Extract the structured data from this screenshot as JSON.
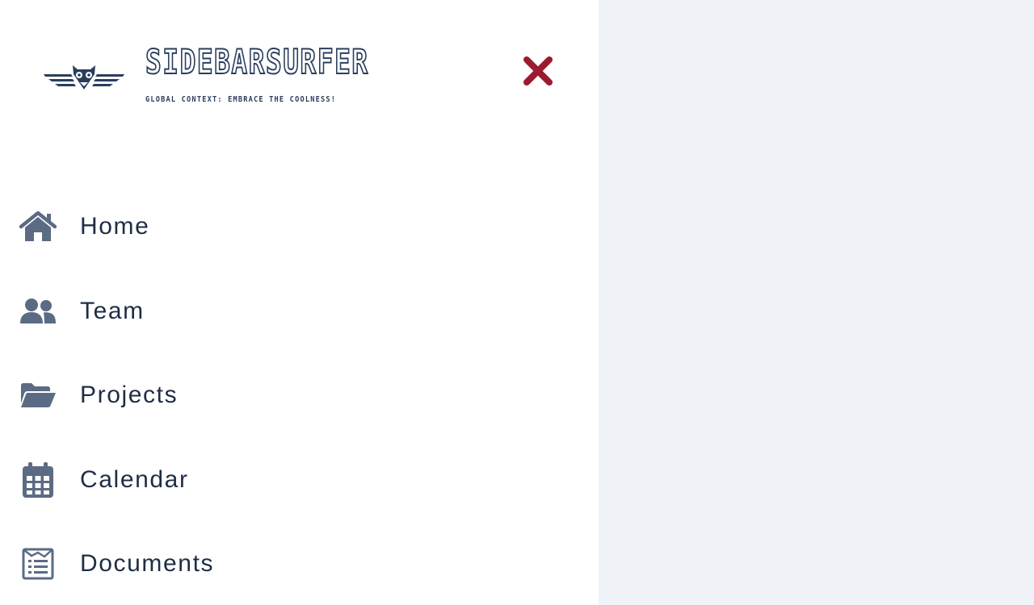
{
  "brand": {
    "name": "SIDEBARSURFER",
    "tagline": "GLOBAL CONTEXT: EMBRACE THE COOLNESS!",
    "logo_icon": "owl-wings-logo",
    "color": "#2a3e5c"
  },
  "close": {
    "icon": "close-icon",
    "color": "#9b1b30"
  },
  "nav": {
    "icon_color": "#5b6b84",
    "label_color": "#1f2d45",
    "items": [
      {
        "label": "Home",
        "icon": "home-icon"
      },
      {
        "label": "Team",
        "icon": "users-icon"
      },
      {
        "label": "Projects",
        "icon": "folder-open-icon"
      },
      {
        "label": "Calendar",
        "icon": "calendar-icon"
      },
      {
        "label": "Documents",
        "icon": "document-icon"
      }
    ]
  },
  "colors": {
    "sidebar_bg": "#ffffff",
    "main_bg": "#eff3f8"
  }
}
